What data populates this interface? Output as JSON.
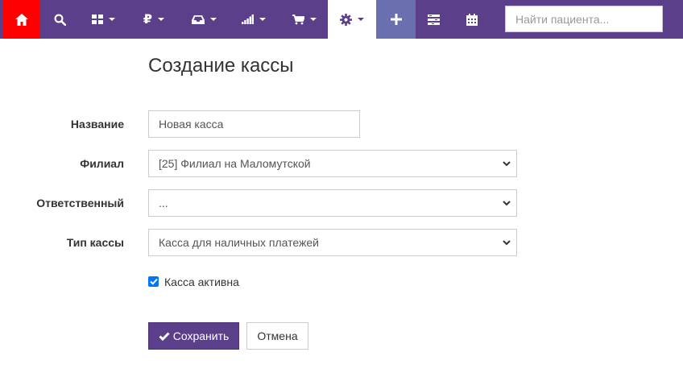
{
  "navbar": {
    "accent_color": "#5b3f8a",
    "home_color": "#ff0000",
    "items": [
      {
        "icon": "home-icon"
      },
      {
        "icon": "search-icon"
      },
      {
        "icon": "grid-icon",
        "has_dropdown": true
      },
      {
        "icon": "ruble-icon",
        "glyph": "₽",
        "has_dropdown": true
      },
      {
        "icon": "inbox-icon",
        "has_dropdown": true
      },
      {
        "icon": "signal-bars-icon",
        "has_dropdown": true
      },
      {
        "icon": "cart-icon",
        "has_dropdown": true
      },
      {
        "icon": "gear-icon",
        "has_dropdown": true,
        "active": true
      },
      {
        "icon": "plus-icon"
      },
      {
        "icon": "list-icon"
      },
      {
        "icon": "calendar-icon"
      }
    ],
    "search": {
      "placeholder": "Найти пациента...",
      "value": ""
    }
  },
  "page": {
    "title": "Создание кассы",
    "form": {
      "name": {
        "label": "Название",
        "value": "Новая касса"
      },
      "branch": {
        "label": "Филиал",
        "value": "[25] Филиал на Маломутской"
      },
      "responsible": {
        "label": "Ответственный",
        "value": "..."
      },
      "type": {
        "label": "Тип кассы",
        "value": "Касса для наличных платежей"
      },
      "active": {
        "label": "Касса активна",
        "checked": true
      }
    },
    "buttons": {
      "save": "Сохранить",
      "cancel": "Отмена"
    }
  }
}
